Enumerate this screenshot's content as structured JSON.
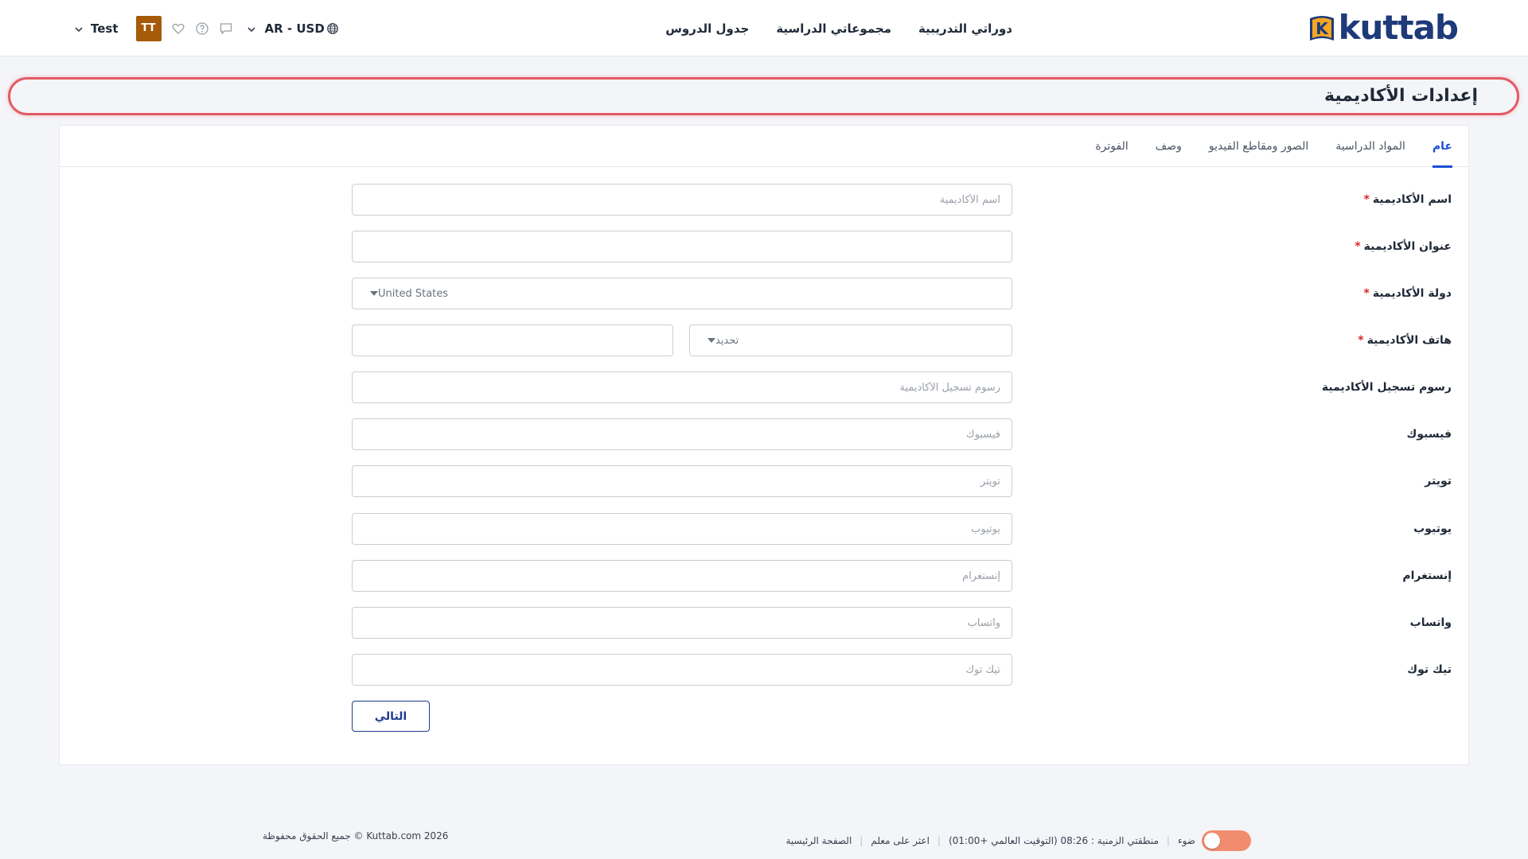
{
  "brand": {
    "logo_text": "kuttab",
    "logo_letter": "K",
    "color": "#1f3a7a"
  },
  "nav": [
    {
      "label": "جدول الدروس"
    },
    {
      "label": "مجموعاتي الدراسية"
    },
    {
      "label": "دوراتي التدريبية"
    }
  ],
  "header_tools": {
    "currency": "AR - USD",
    "avatar_initials": "TT",
    "avatar_color": "#a65b09",
    "user_name": "Test"
  },
  "page_title": "إعدادات الأكاديمية",
  "tabs": [
    {
      "label": "عام",
      "active": true
    },
    {
      "label": "المواد الدراسية"
    },
    {
      "label": "الصور ومقاطع الفيديو"
    },
    {
      "label": "وصف"
    },
    {
      "label": "الفوترة"
    }
  ],
  "form": {
    "name": {
      "label": "اسم الأكاديمية",
      "required": "*",
      "placeholder": "اسم الأكاديمية",
      "value": ""
    },
    "address": {
      "label": "عنوان الأكاديمية",
      "required": "*",
      "placeholder": "",
      "value": ""
    },
    "country": {
      "label": "دولة الأكاديمية",
      "required": "*",
      "value": "United States"
    },
    "phone": {
      "label": "هاتف الأكاديمية",
      "required": "*",
      "code_placeholder": "تحديد",
      "number_placeholder": ""
    },
    "fees": {
      "label": "رسوم تسجيل الأكاديمية",
      "placeholder": "رسوم تسجيل الأكاديمية"
    },
    "facebook": {
      "label": "فيسبوك",
      "placeholder": "فيسبوك"
    },
    "twitter": {
      "label": "تويتر",
      "placeholder": "تويتر"
    },
    "youtube": {
      "label": "يوتيوب",
      "placeholder": "يوتيوب"
    },
    "instagram": {
      "label": "إنستغرام",
      "placeholder": "إنستغرام"
    },
    "whatsapp": {
      "label": "واتساب",
      "placeholder": "واتساب"
    },
    "tiktok": {
      "label": "تيك توك",
      "placeholder": "تيك توك"
    },
    "next_label": "التالي"
  },
  "footer": {
    "home": "الصفحة الرئيسية",
    "find_teacher": "اعثر على معلم",
    "timezone": "منطقتي الزمنية : 08:26 (التوقيت العالمي +01:00)",
    "theme": "ضوء",
    "copyright": "Kuttab.com 2026 © جميع الحقوق محفوظة"
  },
  "colors": {
    "accent": "#1d4ed8",
    "required": "#dc2626",
    "title_outline": "#e35a63",
    "toggle": "#f28c6e"
  }
}
